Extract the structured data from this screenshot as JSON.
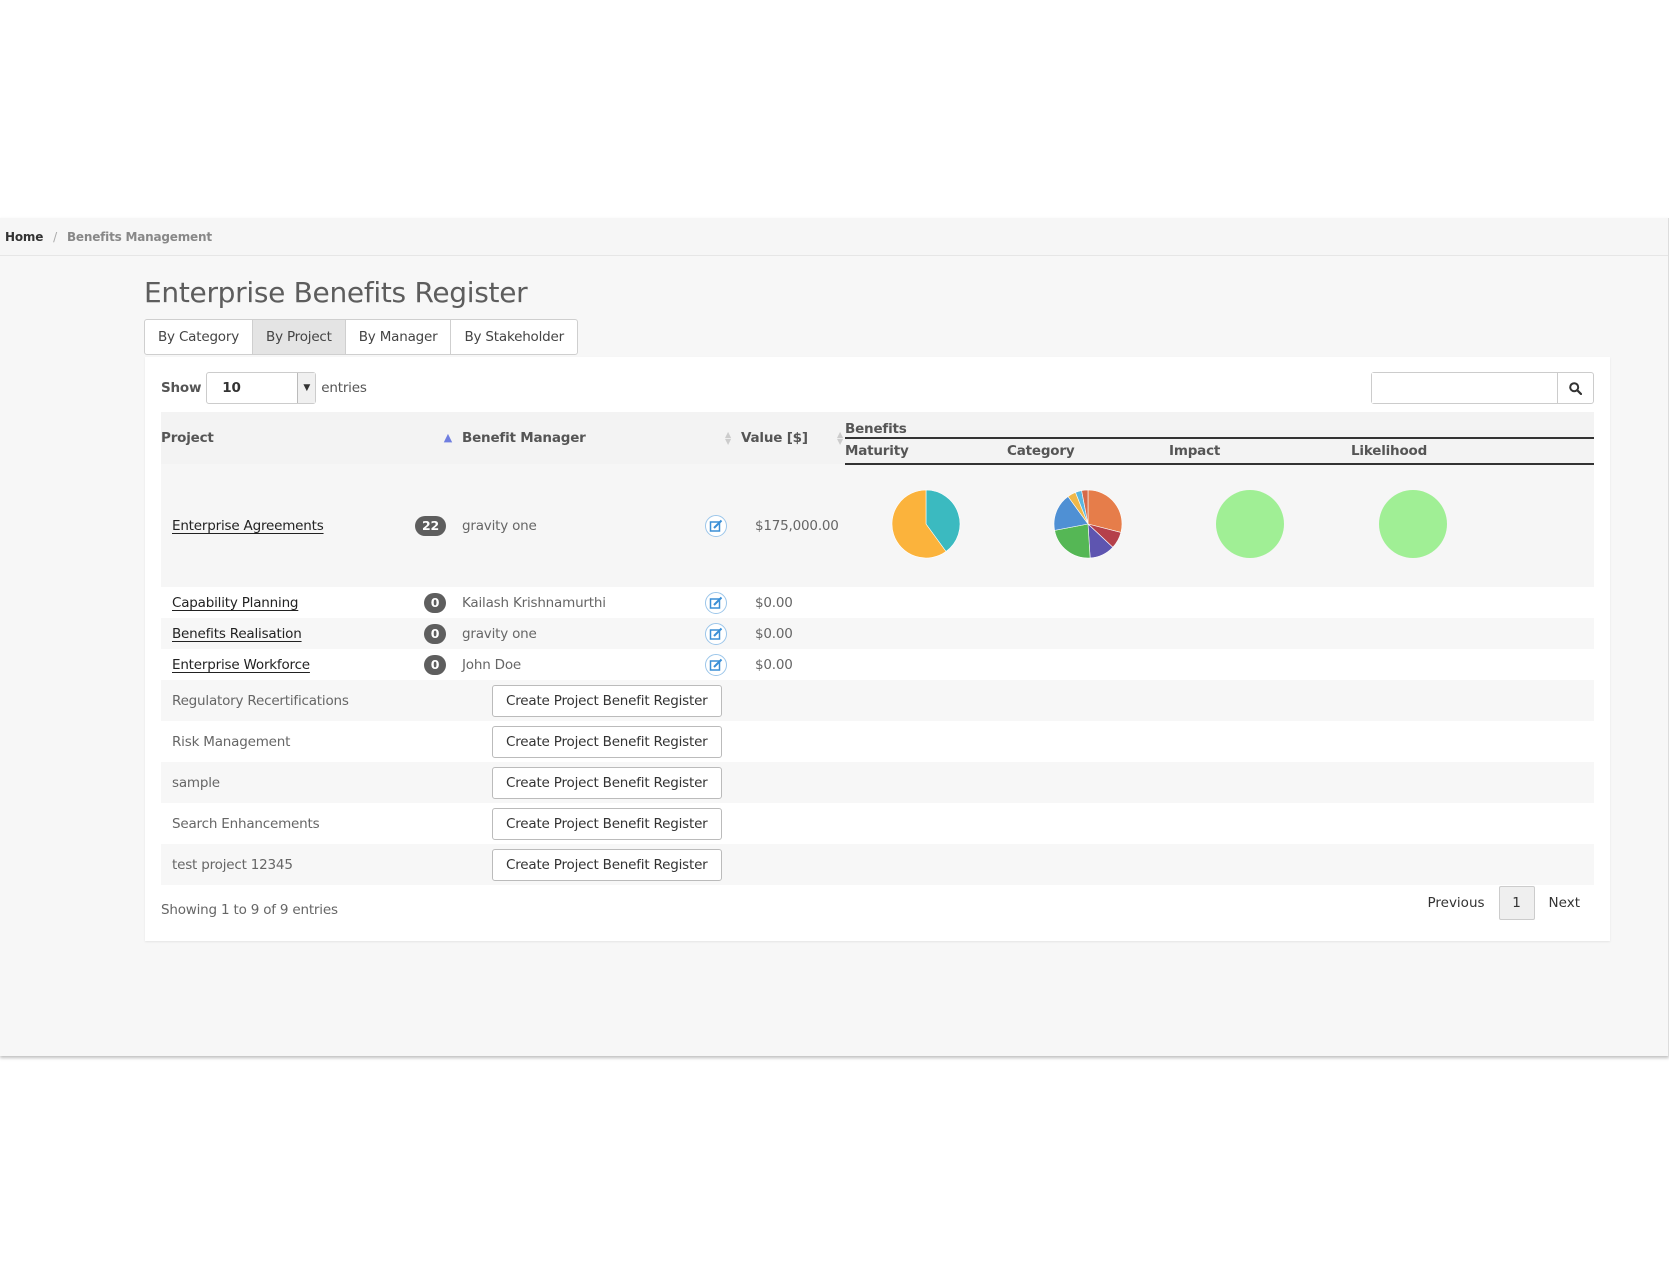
{
  "breadcrumb": {
    "home": "Home",
    "separator": "/",
    "current": "Benefits Management"
  },
  "title": "Enterprise Benefits Register",
  "tabs": [
    {
      "label": "By Category",
      "active": false
    },
    {
      "label": "By Project",
      "active": true
    },
    {
      "label": "By Manager",
      "active": false
    },
    {
      "label": "By Stakeholder",
      "active": false
    }
  ],
  "length_control": {
    "show_label": "Show",
    "value": "10",
    "entries_label": "entries"
  },
  "search": {
    "value": "",
    "icon": "search-icon"
  },
  "columns": {
    "project": "Project",
    "manager": "Benefit Manager",
    "value": "Value [$]",
    "benefits_group": "Benefits",
    "maturity": "Maturity",
    "category": "Category",
    "impact": "Impact",
    "likelihood": "Likelihood"
  },
  "rows": [
    {
      "project": "Enterprise Agreements",
      "count": "22",
      "manager": "gravity one",
      "value": "$175,000.00"
    },
    {
      "project": "Capability Planning",
      "count": "0",
      "manager": "Kailash Krishnamurthi",
      "value": "$0.00"
    },
    {
      "project": "Benefits Realisation",
      "count": "0",
      "manager": "gravity one",
      "value": "$0.00"
    },
    {
      "project": "Enterprise Workforce",
      "count": "0",
      "manager": "John Doe",
      "value": "$0.00"
    }
  ],
  "create_rows": [
    {
      "project": "Regulatory Recertifications",
      "button": "Create Project Benefit Register"
    },
    {
      "project": "Risk Management",
      "button": "Create Project Benefit Register"
    },
    {
      "project": "sample",
      "button": "Create Project Benefit Register"
    },
    {
      "project": "Search Enhancements",
      "button": "Create Project Benefit Register"
    },
    {
      "project": "test project 12345",
      "button": "Create Project Benefit Register"
    }
  ],
  "pies": {
    "maturity": [
      {
        "value": 0.4,
        "color": "#3bbac0"
      },
      {
        "value": 0.6,
        "color": "#fbb33c"
      }
    ],
    "category": [
      {
        "value": 0.29,
        "color": "#e67d4a"
      },
      {
        "value": 0.08,
        "color": "#b5404a"
      },
      {
        "value": 0.12,
        "color": "#5e55b0"
      },
      {
        "value": 0.23,
        "color": "#55b755"
      },
      {
        "value": 0.18,
        "color": "#4f90d4"
      },
      {
        "value": 0.04,
        "color": "#f0b84a"
      },
      {
        "value": 0.03,
        "color": "#59b6e0"
      },
      {
        "value": 0.03,
        "color": "#d66a48"
      }
    ],
    "impact": [
      {
        "value": 1,
        "color": "#a0ef95"
      }
    ],
    "likelihood": [
      {
        "value": 1,
        "color": "#a0ef95"
      }
    ]
  },
  "footer": {
    "info": "Showing 1 to 9 of 9 entries",
    "previous": "Previous",
    "page": "1",
    "next": "Next"
  }
}
